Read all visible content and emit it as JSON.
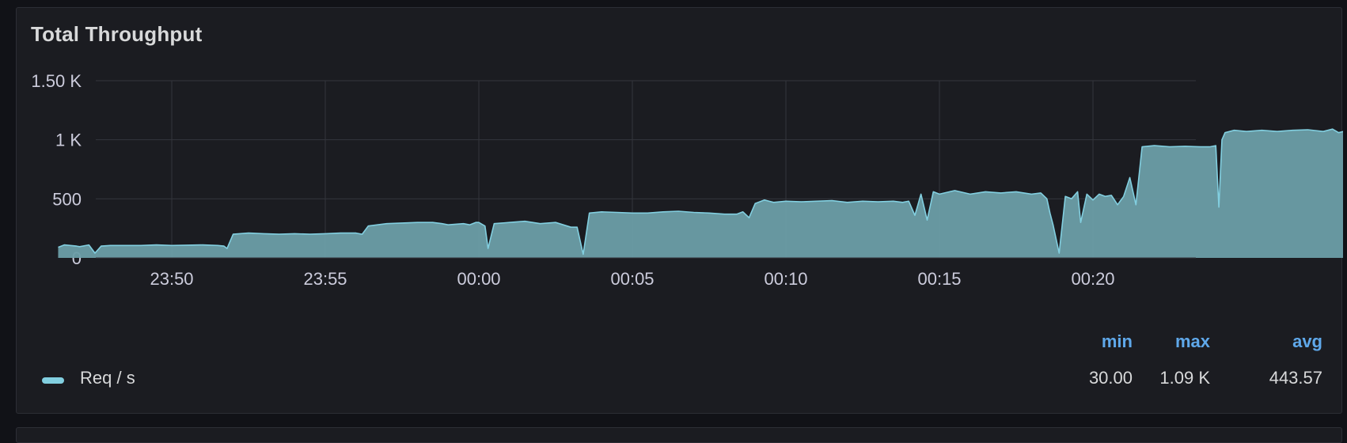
{
  "panel": {
    "title": "Total Throughput"
  },
  "colors": {
    "series": "#82cfe0",
    "fill": "#6b9ea8",
    "grid": "#34363d",
    "axis_text": "#ccccdc",
    "legend_header": "#5fa8ea",
    "background": "#1b1c21"
  },
  "legend": {
    "headers": {
      "min": "min",
      "max": "max",
      "avg": "avg"
    },
    "series": [
      {
        "name": "Req / s",
        "min": "30.00",
        "max": "1.09 K",
        "avg": "443.57"
      }
    ]
  },
  "chart_data": {
    "type": "area",
    "title": "Total Throughput",
    "xlabel": "",
    "ylabel": "",
    "ylim": [
      0,
      1500
    ],
    "y_ticks": [
      {
        "value": 0,
        "label": "0"
      },
      {
        "value": 500,
        "label": "500"
      },
      {
        "value": 1000,
        "label": "1 K"
      },
      {
        "value": 1500,
        "label": "1.50 K"
      }
    ],
    "x_ticks": [
      "23:50",
      "23:55",
      "00:00",
      "00:05",
      "00:10",
      "00:15",
      "00:20"
    ],
    "x_tick_minutes": [
      50,
      55,
      60,
      65,
      70,
      75,
      80
    ],
    "xlim_minutes": [
      46.3,
      82.6
    ],
    "grid": true,
    "legend_position": "bottom",
    "series": [
      {
        "name": "Req / s",
        "points": [
          [
            46.3,
            90
          ],
          [
            46.5,
            110
          ],
          [
            46.9,
            100
          ],
          [
            47.0,
            95
          ],
          [
            47.3,
            110
          ],
          [
            47.5,
            40
          ],
          [
            47.7,
            100
          ],
          [
            48.0,
            105
          ],
          [
            48.5,
            105
          ],
          [
            49.0,
            105
          ],
          [
            49.5,
            110
          ],
          [
            50.0,
            105
          ],
          [
            50.5,
            108
          ],
          [
            51.0,
            110
          ],
          [
            51.5,
            105
          ],
          [
            51.7,
            100
          ],
          [
            51.8,
            80
          ],
          [
            52.0,
            200
          ],
          [
            52.5,
            210
          ],
          [
            53.0,
            205
          ],
          [
            53.5,
            200
          ],
          [
            54.0,
            205
          ],
          [
            54.5,
            200
          ],
          [
            55.0,
            205
          ],
          [
            55.5,
            210
          ],
          [
            56.0,
            210
          ],
          [
            56.2,
            200
          ],
          [
            56.4,
            270
          ],
          [
            57.0,
            290
          ],
          [
            57.5,
            295
          ],
          [
            58.0,
            300
          ],
          [
            58.5,
            300
          ],
          [
            58.8,
            290
          ],
          [
            59.0,
            280
          ],
          [
            59.5,
            290
          ],
          [
            59.7,
            280
          ],
          [
            59.9,
            300
          ],
          [
            60.0,
            300
          ],
          [
            60.2,
            270
          ],
          [
            60.3,
            80
          ],
          [
            60.5,
            290
          ],
          [
            61.0,
            300
          ],
          [
            61.5,
            310
          ],
          [
            62.0,
            290
          ],
          [
            62.5,
            300
          ],
          [
            63.0,
            260
          ],
          [
            63.2,
            260
          ],
          [
            63.4,
            30
          ],
          [
            63.6,
            380
          ],
          [
            64.0,
            390
          ],
          [
            64.5,
            385
          ],
          [
            65.0,
            380
          ],
          [
            65.5,
            380
          ],
          [
            66.0,
            390
          ],
          [
            66.5,
            395
          ],
          [
            67.0,
            385
          ],
          [
            67.5,
            380
          ],
          [
            68.0,
            370
          ],
          [
            68.4,
            370
          ],
          [
            68.6,
            390
          ],
          [
            68.8,
            340
          ],
          [
            69.0,
            460
          ],
          [
            69.3,
            490
          ],
          [
            69.6,
            470
          ],
          [
            70.0,
            480
          ],
          [
            70.5,
            475
          ],
          [
            71.0,
            480
          ],
          [
            71.5,
            485
          ],
          [
            72.0,
            470
          ],
          [
            72.5,
            480
          ],
          [
            73.0,
            475
          ],
          [
            73.5,
            480
          ],
          [
            73.8,
            470
          ],
          [
            74.0,
            480
          ],
          [
            74.2,
            360
          ],
          [
            74.4,
            540
          ],
          [
            74.6,
            320
          ],
          [
            74.8,
            560
          ],
          [
            75.0,
            540
          ],
          [
            75.5,
            570
          ],
          [
            76.0,
            540
          ],
          [
            76.5,
            560
          ],
          [
            77.0,
            550
          ],
          [
            77.5,
            560
          ],
          [
            78.0,
            540
          ],
          [
            78.3,
            550
          ],
          [
            78.5,
            500
          ],
          [
            78.6,
            380
          ],
          [
            78.7,
            280
          ],
          [
            78.9,
            40
          ],
          [
            79.1,
            520
          ],
          [
            79.3,
            500
          ],
          [
            79.5,
            560
          ],
          [
            79.6,
            300
          ],
          [
            79.8,
            540
          ],
          [
            80.0,
            490
          ],
          [
            80.2,
            540
          ],
          [
            80.4,
            520
          ],
          [
            80.6,
            530
          ],
          [
            80.8,
            450
          ],
          [
            81.0,
            520
          ],
          [
            81.2,
            680
          ],
          [
            81.4,
            450
          ],
          [
            81.6,
            940
          ],
          [
            82.0,
            950
          ],
          [
            82.5,
            940
          ],
          [
            83.0,
            945
          ],
          [
            83.5,
            940
          ],
          [
            83.8,
            940
          ],
          [
            84.0,
            950
          ],
          [
            84.1,
            430
          ],
          [
            84.2,
            1000
          ],
          [
            84.3,
            1060
          ],
          [
            84.6,
            1080
          ],
          [
            85.0,
            1070
          ],
          [
            85.5,
            1080
          ],
          [
            86.0,
            1070
          ],
          [
            86.5,
            1080
          ],
          [
            87.0,
            1085
          ],
          [
            87.5,
            1070
          ],
          [
            87.8,
            1090
          ],
          [
            88.0,
            1060
          ],
          [
            88.3,
            1080
          ],
          [
            88.5,
            1050
          ],
          [
            88.6,
            940
          ],
          [
            88.8,
            1080
          ],
          [
            89.0,
            1075
          ],
          [
            89.1,
            360
          ]
        ]
      }
    ]
  }
}
